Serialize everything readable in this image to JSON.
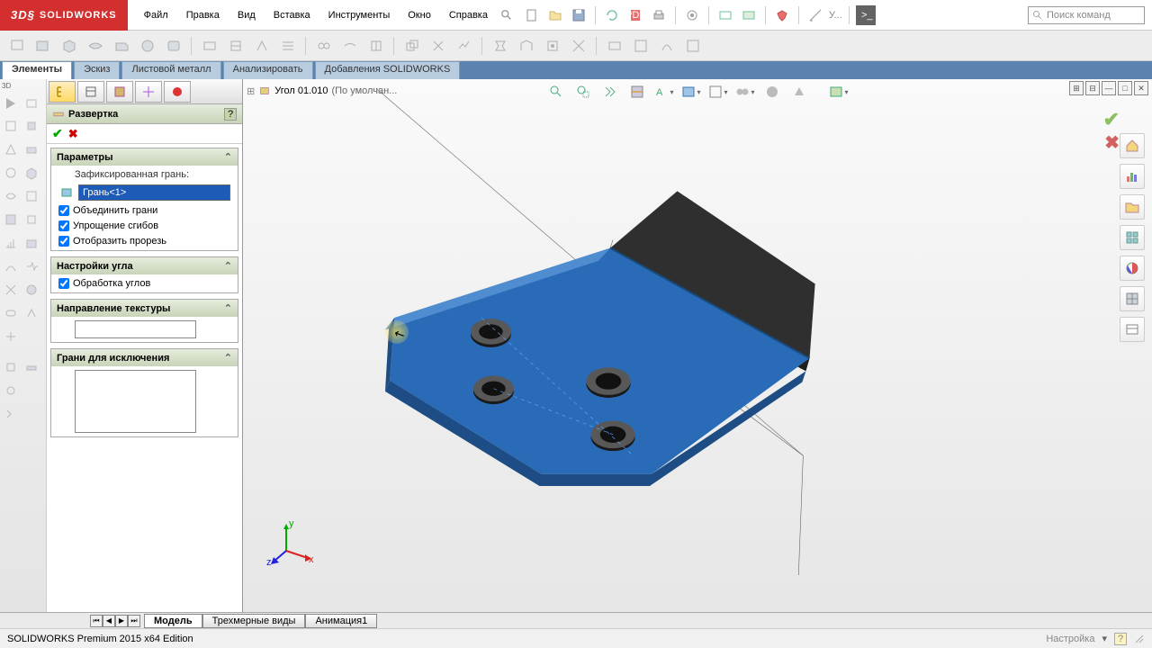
{
  "app": {
    "name": "SOLIDWORKS"
  },
  "menu": {
    "file": "Файл",
    "edit": "Правка",
    "view": "Вид",
    "insert": "Вставка",
    "tools": "Инструменты",
    "window": "Окно",
    "help": "Справка"
  },
  "search_top": {
    "placeholder": "Поиск команд",
    "hint": "У..."
  },
  "ribbon": {
    "elements": "Элементы",
    "sketch": "Эскиз",
    "sheetmetal": "Листовой металл",
    "analyze": "Анализировать",
    "addins": "Добавления SOLIDWORKS"
  },
  "breadcrumb": {
    "part": "Угол 01.010",
    "config": "(По умолчан..."
  },
  "panel": {
    "title": "Развертка",
    "params_title": "Параметры",
    "fixed_face": "Зафиксированная грань:",
    "face_value": "Грань<1>",
    "merge_faces": "Объединить грани",
    "simplify_bends": "Упрощение сгибов",
    "show_slot": "Отобразить прорезь",
    "corner_title": "Настройки угла",
    "corner_treat": "Обработка углов",
    "texture_title": "Направление текстуры",
    "exclude_title": "Грани для исключения"
  },
  "bottom_tabs": {
    "model": "Модель",
    "views3d": "Трехмерные виды",
    "anim": "Анимация1"
  },
  "status": {
    "version": "SOLIDWORKS Premium 2015 x64 Edition",
    "custom": "Настройка",
    "help": "?"
  },
  "triad": {
    "x": "x",
    "y": "y",
    "z": "z"
  }
}
